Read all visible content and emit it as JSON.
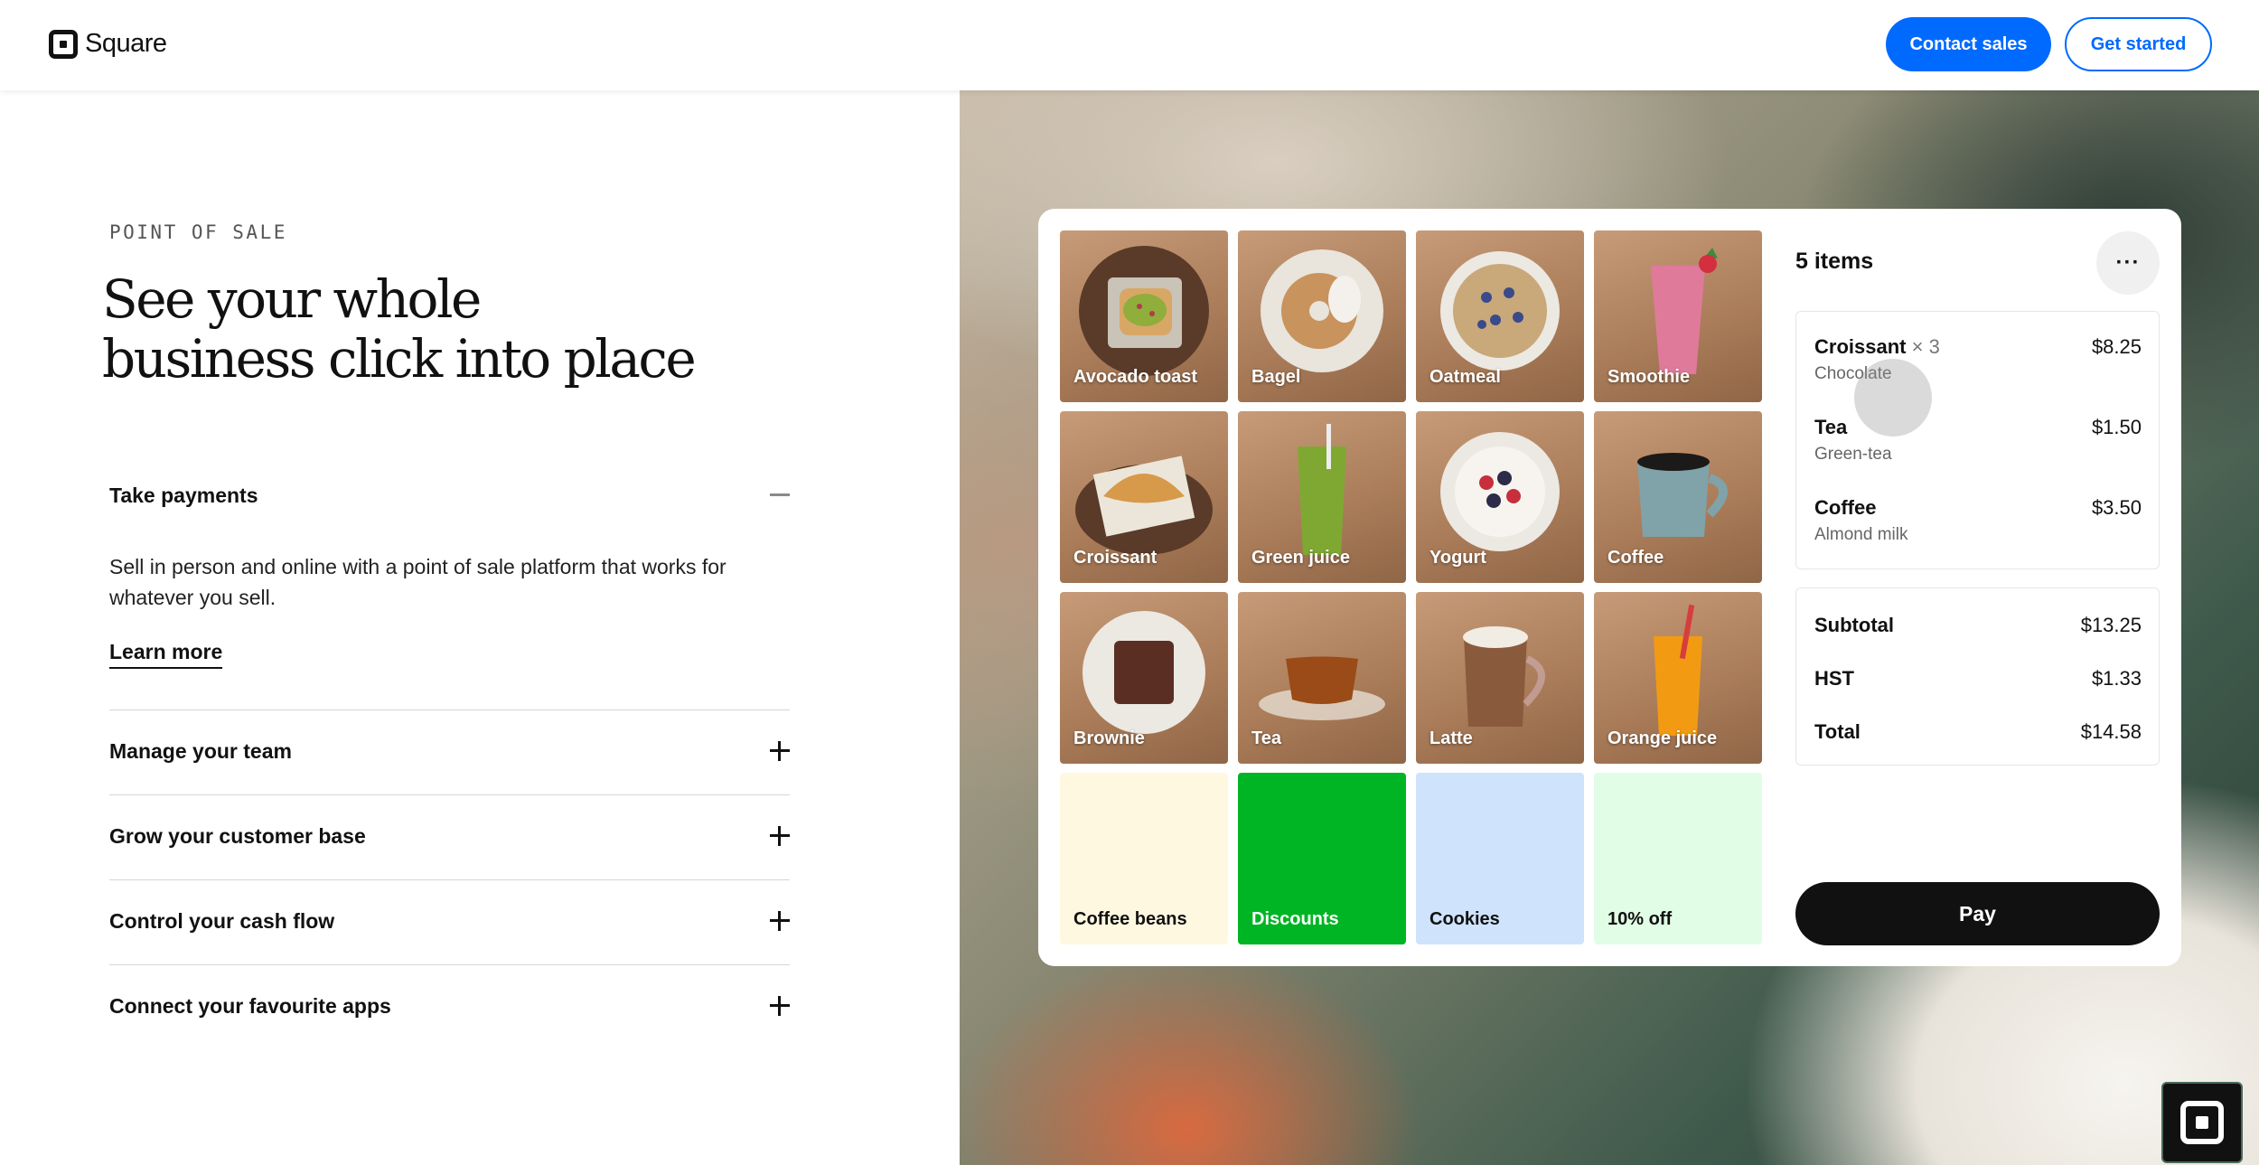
{
  "header": {
    "brand": "Square",
    "contact_sales": "Contact sales",
    "get_started": "Get started"
  },
  "hero": {
    "eyebrow": "POINT OF SALE",
    "headline_line1": "See your whole",
    "headline_line2": "business click into place"
  },
  "accordion": {
    "open_item": {
      "title": "Take payments",
      "body": "Sell in person and online with a point of sale platform that works for whatever you sell.",
      "link": "Learn more"
    },
    "items": [
      {
        "label": "Manage your team"
      },
      {
        "label": "Grow your customer base"
      },
      {
        "label": "Control your cash flow"
      },
      {
        "label": "Connect your favourite apps"
      }
    ]
  },
  "pos": {
    "tiles": [
      {
        "label": "Avocado toast",
        "icon": "avocado-toast"
      },
      {
        "label": "Bagel",
        "icon": "bagel"
      },
      {
        "label": "Oatmeal",
        "icon": "oatmeal"
      },
      {
        "label": "Smoothie",
        "icon": "smoothie"
      },
      {
        "label": "Croissant",
        "icon": "croissant"
      },
      {
        "label": "Green juice",
        "icon": "green-juice"
      },
      {
        "label": "Yogurt",
        "icon": "yogurt"
      },
      {
        "label": "Coffee",
        "icon": "coffee"
      },
      {
        "label": "Brownie",
        "icon": "brownie"
      },
      {
        "label": "Tea",
        "icon": "tea"
      },
      {
        "label": "Latte",
        "icon": "latte"
      },
      {
        "label": "Orange juice",
        "icon": "orange-juice"
      }
    ],
    "category_tiles": [
      {
        "label": "Coffee beans",
        "color": "#fff8e1"
      },
      {
        "label": "Discounts",
        "color": "#00b523"
      },
      {
        "label": "Cookies",
        "color": "#cfe3fc"
      },
      {
        "label": "10% off",
        "color": "#e2fde6"
      }
    ],
    "items_count": "5 items",
    "more_label": "···",
    "order": [
      {
        "name": "Croissant",
        "qty": "× 3",
        "modifier": "Chocolate",
        "price": "$8.25"
      },
      {
        "name": "Tea",
        "qty": "",
        "modifier": "Green-tea",
        "price": "$1.50"
      },
      {
        "name": "Coffee",
        "qty": "",
        "modifier": "Almond milk",
        "price": "$3.50"
      }
    ],
    "totals": [
      {
        "label": "Subtotal",
        "value": "$13.25"
      },
      {
        "label": "HST",
        "value": "$1.33"
      },
      {
        "label": "Total",
        "value": "$14.58"
      }
    ],
    "pay_label": "Pay"
  },
  "colors": {
    "accent": "#006aff",
    "pay_button": "#111111"
  }
}
